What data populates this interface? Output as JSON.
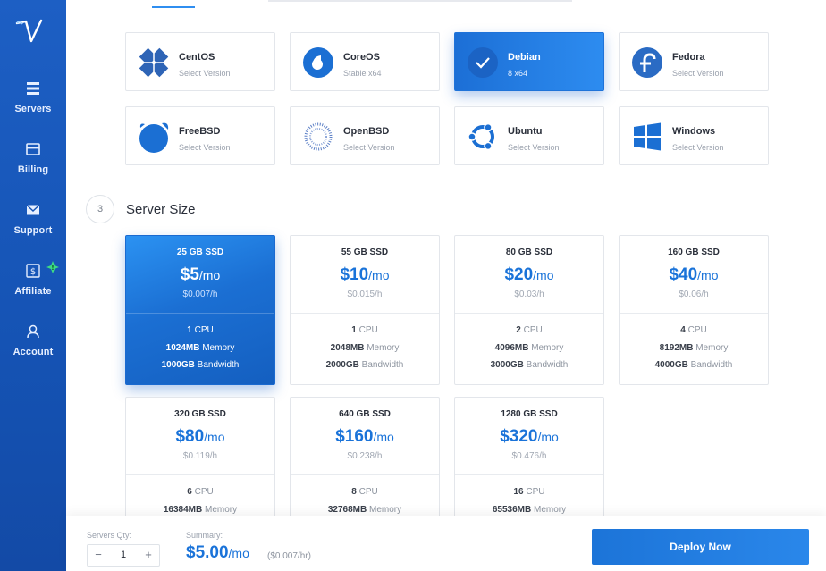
{
  "sidebar": {
    "items": [
      {
        "label": "Servers",
        "icon": "servers-list-icon"
      },
      {
        "label": "Billing",
        "icon": "credit-card-icon"
      },
      {
        "label": "Support",
        "icon": "envelope-icon"
      },
      {
        "label": "Affiliate",
        "icon": "dollar-box-icon"
      },
      {
        "label": "Account",
        "icon": "person-icon"
      }
    ],
    "affiliate_badge": "!"
  },
  "os": {
    "items": [
      {
        "name": "CentOS",
        "sub": "Select Version"
      },
      {
        "name": "CoreOS",
        "sub": "Stable  x64"
      },
      {
        "name": "Debian",
        "sub": "8  x64"
      },
      {
        "name": "Fedora",
        "sub": "Select Version"
      },
      {
        "name": "FreeBSD",
        "sub": "Select Version"
      },
      {
        "name": "OpenBSD",
        "sub": "Select Version"
      },
      {
        "name": "Ubuntu",
        "sub": "Select Version"
      },
      {
        "name": "Windows",
        "sub": "Select Version"
      }
    ],
    "selected": "Debian"
  },
  "size_section": {
    "step": "3",
    "title": "Server Size"
  },
  "sizes": [
    {
      "disk": "25 GB SSD",
      "amount": "$5",
      "per": "/mo",
      "hourly": "$0.007/h",
      "cpu": "1",
      "cpu_label": " CPU",
      "memory": "1024MB",
      "memory_label": " Memory",
      "bandwidth": "1000GB",
      "bandwidth_label": " Bandwidth"
    },
    {
      "disk": "55 GB SSD",
      "amount": "$10",
      "per": "/mo",
      "hourly": "$0.015/h",
      "cpu": "1",
      "cpu_label": " CPU",
      "memory": "2048MB",
      "memory_label": " Memory",
      "bandwidth": "2000GB",
      "bandwidth_label": " Bandwidth"
    },
    {
      "disk": "80 GB SSD",
      "amount": "$20",
      "per": "/mo",
      "hourly": "$0.03/h",
      "cpu": "2",
      "cpu_label": " CPU",
      "memory": "4096MB",
      "memory_label": " Memory",
      "bandwidth": "3000GB",
      "bandwidth_label": " Bandwidth"
    },
    {
      "disk": "160 GB SSD",
      "amount": "$40",
      "per": "/mo",
      "hourly": "$0.06/h",
      "cpu": "4",
      "cpu_label": " CPU",
      "memory": "8192MB",
      "memory_label": " Memory",
      "bandwidth": "4000GB",
      "bandwidth_label": " Bandwidth"
    },
    {
      "disk": "320 GB SSD",
      "amount": "$80",
      "per": "/mo",
      "hourly": "$0.119/h",
      "cpu": "6",
      "cpu_label": " CPU",
      "memory": "16384MB",
      "memory_label": " Memory",
      "bandwidth": "",
      "bandwidth_label": ""
    },
    {
      "disk": "640 GB SSD",
      "amount": "$160",
      "per": "/mo",
      "hourly": "$0.238/h",
      "cpu": "8",
      "cpu_label": " CPU",
      "memory": "32768MB",
      "memory_label": " Memory",
      "bandwidth": "",
      "bandwidth_label": ""
    },
    {
      "disk": "1280 GB SSD",
      "amount": "$320",
      "per": "/mo",
      "hourly": "$0.476/h",
      "cpu": "16",
      "cpu_label": " CPU",
      "memory": "65536MB",
      "memory_label": " Memory",
      "bandwidth": "",
      "bandwidth_label": ""
    }
  ],
  "footer": {
    "qty_label": "Servers Qty:",
    "qty_minus": "−",
    "qty_value": "1",
    "qty_plus": "+",
    "summary_label": "Summary:",
    "summary_amount": "$5.00",
    "summary_per": "/mo",
    "summary_hourly": "($0.007/hr)",
    "deploy_label": "Deploy Now"
  },
  "colors": {
    "sidebar": "#1553b4",
    "accent": "#1a73d9",
    "muted": "#9aa1ad"
  }
}
